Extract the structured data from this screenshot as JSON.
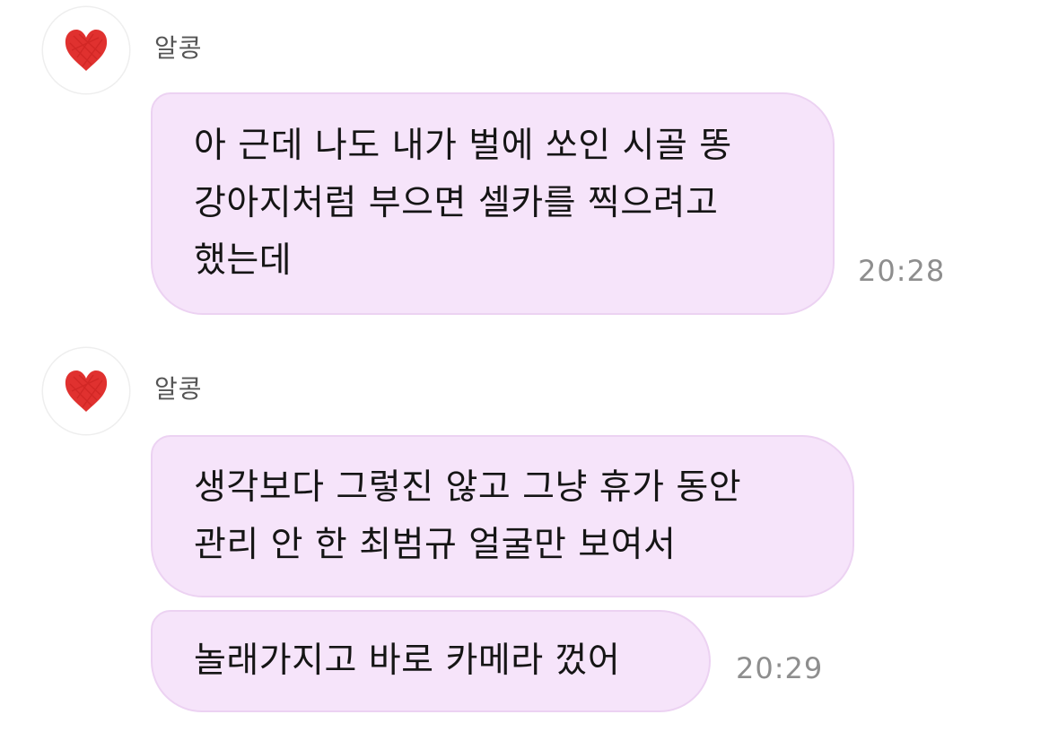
{
  "chat": {
    "groups": [
      {
        "sender": "알콩",
        "messages": [
          {
            "text": "아 근데 나도 내가 벌에 쏘인 시골 똥\n강아지처럼 부으면 셀카를 찍으려고\n했는데",
            "time": "20:28"
          }
        ]
      },
      {
        "sender": "알콩",
        "messages": [
          {
            "text": "생각보다 그렇진 않고 그냥 휴가 동안\n관리 안 한 최범규 얼굴만 보여서",
            "time": ""
          },
          {
            "text": "놀래가지고 바로 카메라 껐어",
            "time": "20:29"
          }
        ]
      }
    ]
  },
  "colors": {
    "bubble_bg": "#f6e4fa",
    "bubble_border": "#ecd2f2",
    "heart": "#e0312f",
    "time": "#8e8e8e",
    "sender": "#555555"
  },
  "icons": {
    "avatar": "red-heart-icon"
  }
}
